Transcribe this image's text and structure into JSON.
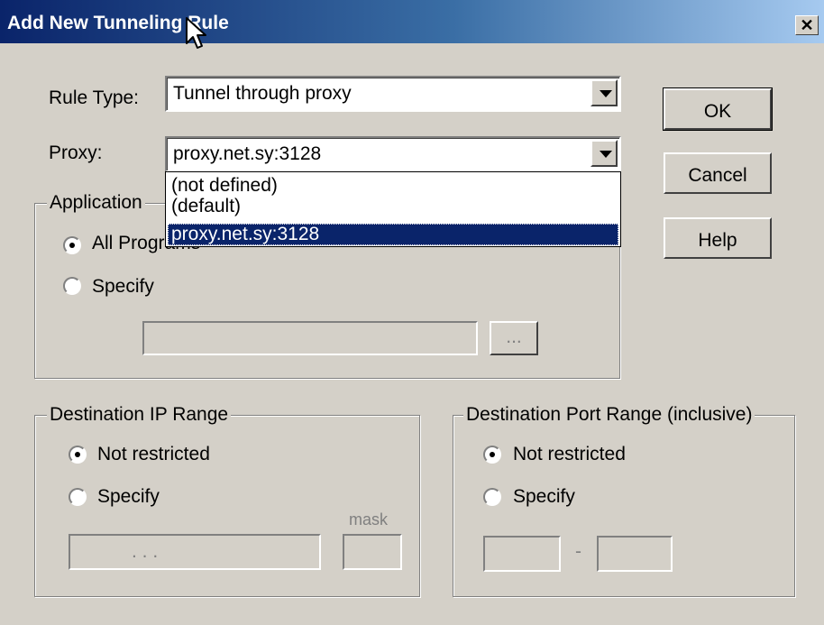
{
  "window": {
    "title": "Add New Tunneling Rule"
  },
  "rule_type": {
    "label": "Rule Type:",
    "value": "Tunnel through proxy"
  },
  "proxy": {
    "label": "Proxy:",
    "value": "proxy.net.sy:3128",
    "options": [
      "(not defined)",
      "(default)",
      "proxy.net.sy:3128"
    ],
    "selected_option": "proxy.net.sy:3128"
  },
  "buttons": {
    "ok": "OK",
    "cancel": "Cancel",
    "help": "Help",
    "browse": "..."
  },
  "application": {
    "group_label": "Application",
    "all_programs_label": "All Programs",
    "specify_label": "Specify",
    "selected": "All Programs"
  },
  "dest_ip": {
    "group_label": "Destination IP Range",
    "not_restricted_label": "Not restricted",
    "specify_label": "Specify",
    "mask_label": "mask",
    "selected": "Not restricted",
    "ip_separators": ". . ."
  },
  "dest_port": {
    "group_label": "Destination Port Range (inclusive)",
    "not_restricted_label": "Not restricted",
    "specify_label": "Specify",
    "range_separator": "-",
    "selected": "Not restricted"
  },
  "icons": {
    "close": "close-icon",
    "cursor": "mouse-cursor-icon",
    "dropdown": "chevron-down-icon"
  }
}
